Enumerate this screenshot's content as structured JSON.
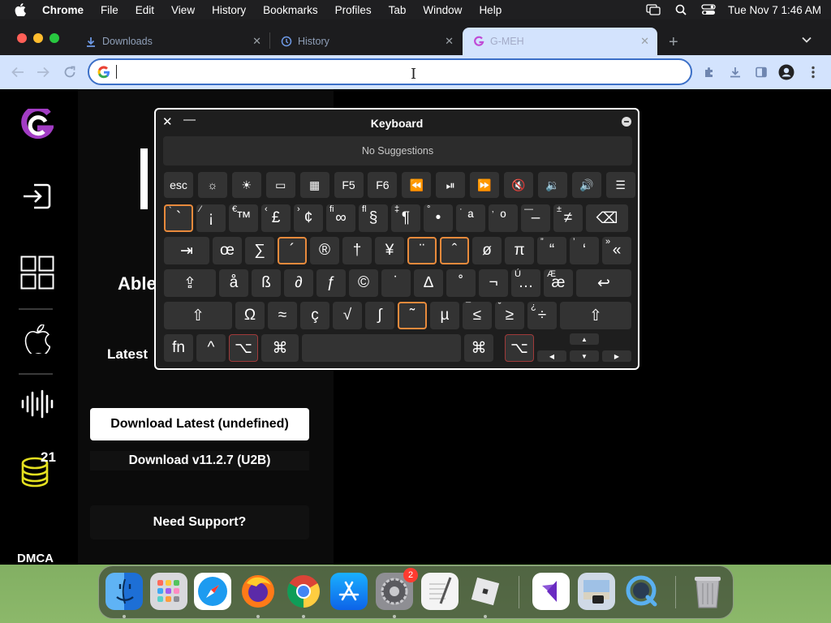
{
  "menubar": {
    "app": "Chrome",
    "items": [
      "File",
      "Edit",
      "View",
      "History",
      "Bookmarks",
      "Profiles",
      "Tab",
      "Window",
      "Help"
    ],
    "clock": "Tue Nov 7  1:46 AM"
  },
  "tabs": [
    {
      "title": "Downloads",
      "icon": "download-icon"
    },
    {
      "title": "History",
      "icon": "history-icon"
    },
    {
      "title": "G-MEH",
      "icon": "g-logo-icon",
      "active": true
    }
  ],
  "omnibox": {
    "value": "",
    "placeholder": ""
  },
  "sidebar": {
    "badge_count": "21",
    "dmca": "DMCA"
  },
  "main": {
    "partial_heading": "Able",
    "latest_label": "Latest",
    "download_latest": "Download Latest (undefined)",
    "download_version": "Download v11.2.7 (U2B)",
    "support": "Need Support?"
  },
  "keyboard": {
    "title": "Keyboard",
    "suggestions": "No Suggestions",
    "row0": [
      "esc",
      "☼",
      "☀",
      "▭",
      "▦",
      "F5",
      "F6",
      "⏪",
      "⏯",
      "⏩",
      "🔇",
      "🔉",
      "🔊",
      "☰"
    ],
    "row1": [
      {
        "main": "`",
        "sup": "`"
      },
      {
        "main": "¡",
        "sup": "⁄"
      },
      {
        "main": "™",
        "sup": "€"
      },
      {
        "main": "£",
        "sup": "‹"
      },
      {
        "main": "¢",
        "sup": "›"
      },
      {
        "main": "∞",
        "sup": "ﬁ"
      },
      {
        "main": "§",
        "sup": "ﬂ"
      },
      {
        "main": "¶",
        "sup": "‡"
      },
      {
        "main": "•",
        "sup": "°"
      },
      {
        "main": "ª",
        "sup": "·"
      },
      {
        "main": "º",
        "sup": "‚"
      },
      {
        "main": "–",
        "sup": "—"
      },
      {
        "main": "≠",
        "sup": "±"
      },
      {
        "main": "⌫",
        "sup": ""
      }
    ],
    "row2": [
      "⇥",
      "œ",
      "∑",
      "´",
      "®",
      "†",
      "¥",
      "¨",
      "ˆ",
      "ø",
      "π",
      "“",
      "‘",
      "«"
    ],
    "row2_sup": [
      "",
      "",
      "",
      "",
      "",
      "",
      "",
      "",
      "",
      "",
      "",
      "”",
      "’",
      "»"
    ],
    "row3": [
      "⇪",
      "å",
      "ß",
      "∂",
      "ƒ",
      "©",
      "˙",
      "∆",
      "˚",
      "¬",
      "…",
      "æ",
      "↩"
    ],
    "row3_sup": [
      "",
      "",
      "",
      "",
      "",
      "",
      "",
      "",
      "",
      "",
      "Ú",
      "Æ",
      ""
    ],
    "row4": [
      "⇧",
      "Ω",
      "≈",
      "ç",
      "√",
      "∫",
      "˜",
      "µ",
      "≤",
      "≥",
      "÷",
      "⇧"
    ],
    "row4_sup": [
      "",
      "",
      "",
      "",
      "",
      "",
      "",
      "",
      "¯",
      "˘",
      "¿",
      ""
    ],
    "row5": [
      "fn",
      "^",
      "⌥",
      "⌘",
      "",
      "⌘",
      "⌥"
    ],
    "arrows": [
      "▲",
      "◀",
      "▼",
      "▶"
    ]
  },
  "dock": {
    "apps": [
      "Finder",
      "Launchpad",
      "Safari",
      "Firefox",
      "Chrome",
      "App Store",
      "System Settings",
      "TextEdit",
      "Roblox",
      "Visual Studio",
      "Preview",
      "QuickTime",
      "Trash"
    ],
    "settings_badge": "2"
  }
}
